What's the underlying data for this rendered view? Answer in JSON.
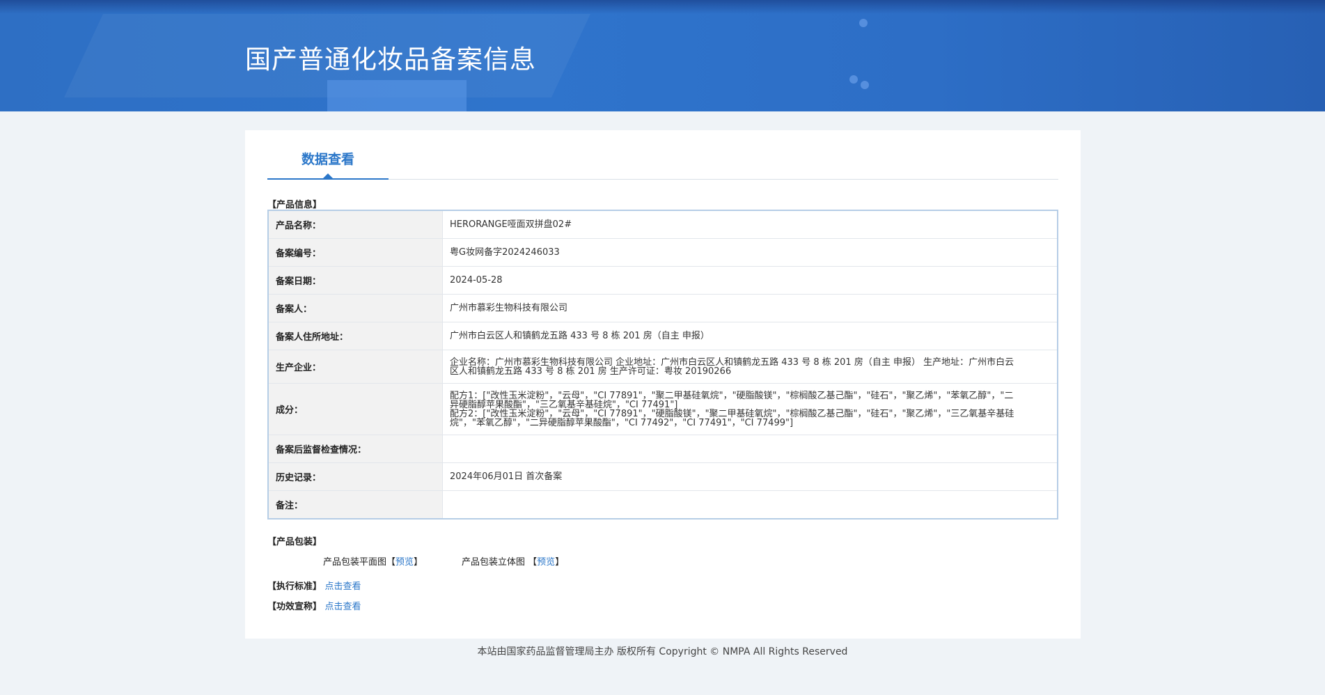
{
  "header": {
    "title": "国产普通化妆品备案信息"
  },
  "tabs": [
    {
      "label": "数据查看"
    }
  ],
  "product_info": {
    "section_label": "【产品信息】",
    "rows": [
      {
        "label": "产品名称：",
        "value": "HERORANGE哑面双拼盘02#"
      },
      {
        "label": "备案编号：",
        "value": "粤G妆网备字2024246033"
      },
      {
        "label": "备案日期：",
        "value": "2024-05-28"
      },
      {
        "label": "备案人：",
        "value": "广州市慕彩生物科技有限公司"
      },
      {
        "label": "备案人住所地址：",
        "value": "广州市白云区人和镇鹤龙五路 433 号 8 栋 201 房（自主 申报）"
      },
      {
        "label": "生产企业：",
        "value": "企业名称：广州市慕彩生物科技有限公司 企业地址：广州市白云区人和镇鹤龙五路 433 号 8 栋 201 房（自主 申报） 生产地址：广州市白云区人和镇鹤龙五路 433 号 8 栋 201 房 生产许可证：粤妆 20190266"
      },
      {
        "label": "成分：",
        "value": "配方1：[\"改性玉米淀粉\"，\"云母\"，\"CI 77891\"，\"聚二甲基硅氧烷\"，\"硬脂酸镁\"，\"棕榈酸乙基己酯\"，\"硅石\"，\"聚乙烯\"，\"苯氧乙醇\"，\"二异硬脂醇苹果酸酯\"，\"三乙氧基辛基硅烷\"，\"CI 77491\"]",
        "value2": "配方2：[\"改性玉米淀粉\"，\"云母\"，\"CI 77891\"，\"硬脂酸镁\"，\"聚二甲基硅氧烷\"，\"棕榈酸乙基己酯\"，\"硅石\"，\"聚乙烯\"，\"三乙氧基辛基硅烷\"，\"苯氧乙醇\"，\"二异硬脂醇苹果酸酯\"，\"CI 77492\"，\"CI 77491\"，\"CI 77499\"]"
      },
      {
        "label": "备案后监督检查情况：",
        "value": ""
      },
      {
        "label": "历史记录：",
        "value": "2024年06月01日 首次备案"
      },
      {
        "label": "备注：",
        "value": ""
      }
    ]
  },
  "packaging": {
    "section_label": "【产品包装】",
    "flat_label": "产品包装平面图",
    "solid_label": "产品包装立体图",
    "bracket_open": "【",
    "bracket_close": "】",
    "preview_link": "预览"
  },
  "standard": {
    "label": "【执行标准】",
    "link": "点击查看"
  },
  "efficacy": {
    "label": "【功效宣称】",
    "link": "点击查看"
  },
  "footer": {
    "text": "本站由国家药品监督管理局主办 版权所有 Copyright © NMPA All Rights Reserved"
  },
  "colors": {
    "banner": "#2f74cc",
    "accent": "#2b77c9",
    "table_border": "#b6cde6",
    "label_bg": "#f2f2f2",
    "page_bg": "#eff3f7"
  }
}
